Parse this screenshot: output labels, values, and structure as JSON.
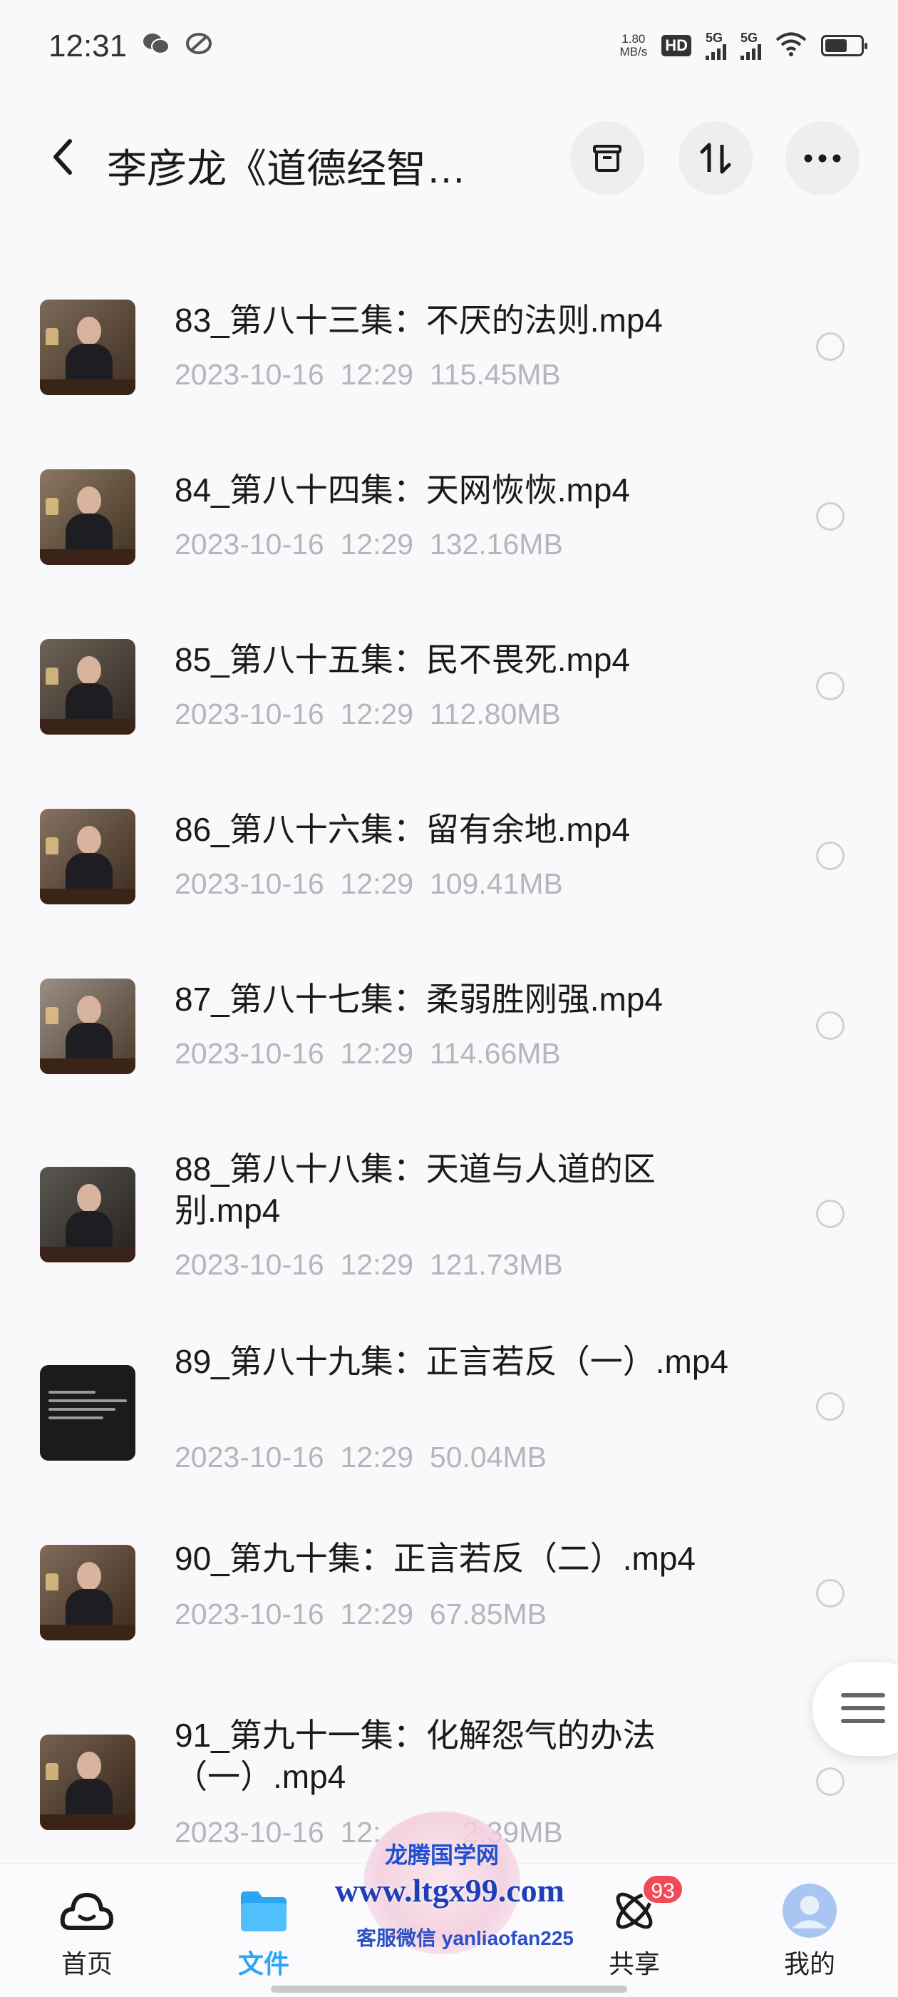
{
  "status_bar": {
    "time": "12:31",
    "net_speed_value": "1.80",
    "net_speed_unit": "MB/s",
    "hd_badge": "HD",
    "sim1_label": "5G",
    "sim2_label": "5G",
    "left_icons": [
      "wechat-icon",
      "app-notification-icon"
    ]
  },
  "header": {
    "title": "李彦龙《道德经智…",
    "buttons": [
      "archive-icon",
      "sort-icon",
      "more-icon"
    ]
  },
  "files": [
    {
      "name": "83_第八十三集：不厌的法则.mp4",
      "date": "2023-10-16",
      "time": "12:29",
      "size": "115.45MB",
      "meta": "2023-10-16  12:29  115.45MB"
    },
    {
      "name": "84_第八十四集：天网恢恢.mp4",
      "date": "2023-10-16",
      "time": "12:29",
      "size": "132.16MB",
      "meta": "2023-10-16  12:29  132.16MB"
    },
    {
      "name": "85_第八十五集：民不畏死.mp4",
      "date": "2023-10-16",
      "time": "12:29",
      "size": "112.80MB",
      "meta": "2023-10-16  12:29  112.80MB"
    },
    {
      "name": "86_第八十六集：留有余地.mp4",
      "date": "2023-10-16",
      "time": "12:29",
      "size": "109.41MB",
      "meta": "2023-10-16  12:29  109.41MB"
    },
    {
      "name": "87_第八十七集：柔弱胜刚强.mp4",
      "date": "2023-10-16",
      "time": "12:29",
      "size": "114.66MB",
      "meta": "2023-10-16  12:29  114.66MB"
    },
    {
      "name": "88_第八十八集：天道与人道的区别.mp4",
      "date": "2023-10-16",
      "time": "12:29",
      "size": "121.73MB",
      "meta": "2023-10-16  12:29  121.73MB"
    },
    {
      "name": "89_第八十九集：正言若反（一）.mp4",
      "date": "2023-10-16",
      "time": "12:29",
      "size": "50.04MB",
      "meta": "2023-10-16  12:29  50.04MB"
    },
    {
      "name": "90_第九十集：正言若反（二）.mp4",
      "date": "2023-10-16",
      "time": "12:29",
      "size": "67.85MB",
      "meta": "2023-10-16  12:29  67.85MB"
    },
    {
      "name": "91_第九十一集：化解怨气的办法（一）.mp4",
      "date": "2023-10-16",
      "time": "12:",
      "size": "2.39MB",
      "meta": "2023-10-16  12:          2.39MB"
    }
  ],
  "bottom_nav": {
    "items": [
      {
        "label": "首页",
        "icon": "cloud-home-icon"
      },
      {
        "label": "文件",
        "icon": "folder-icon",
        "active": true
      },
      {
        "label": "",
        "icon": "center-icon"
      },
      {
        "label": "共享",
        "icon": "share-atom-icon",
        "badge": "93"
      },
      {
        "label": "我的",
        "icon": "avatar-icon"
      }
    ]
  },
  "watermark": {
    "title": "龙腾国学网",
    "url": "www.ltgx99.com",
    "contact": "客服微信 yanliaofan225"
  },
  "colors": {
    "accent": "#2aa6f5",
    "badge": "#f24b58",
    "meta_text": "#b5b5bb"
  }
}
